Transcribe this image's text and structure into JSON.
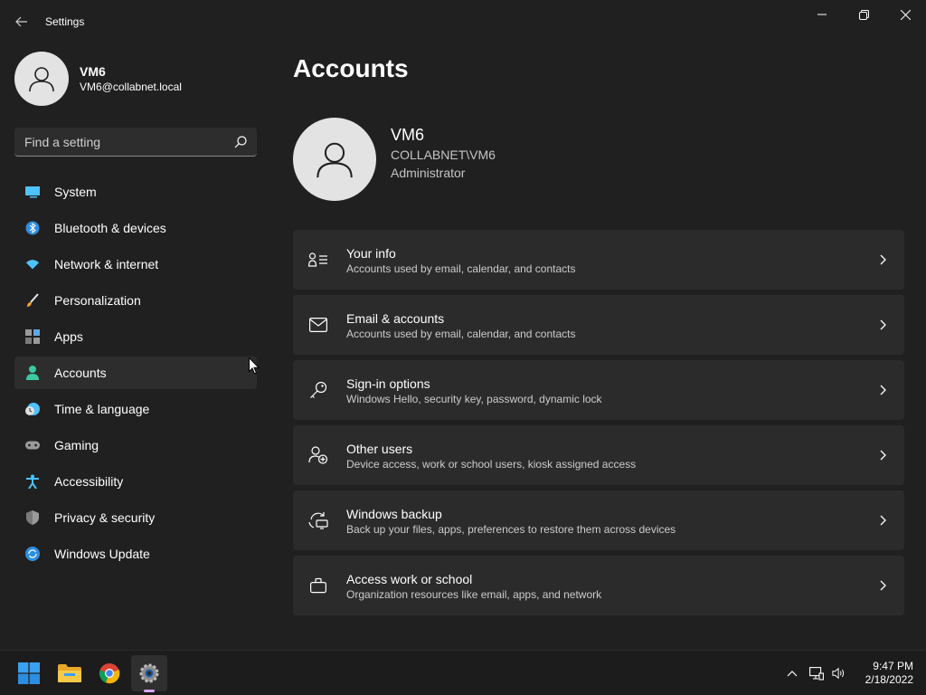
{
  "window": {
    "title": "Settings",
    "controls": [
      "minimize",
      "maximize",
      "close"
    ]
  },
  "profile": {
    "name": "VM6",
    "email": "VM6@collabnet.local"
  },
  "search": {
    "placeholder": "Find a setting"
  },
  "sidebar": {
    "items": [
      {
        "label": "System",
        "icon": "system-icon",
        "active": false
      },
      {
        "label": "Bluetooth & devices",
        "icon": "bluetooth-icon",
        "active": false
      },
      {
        "label": "Network & internet",
        "icon": "wifi-icon",
        "active": false
      },
      {
        "label": "Personalization",
        "icon": "brush-icon",
        "active": false
      },
      {
        "label": "Apps",
        "icon": "apps-icon",
        "active": false
      },
      {
        "label": "Accounts",
        "icon": "person-icon",
        "active": true
      },
      {
        "label": "Time & language",
        "icon": "clock-globe-icon",
        "active": false
      },
      {
        "label": "Gaming",
        "icon": "gamepad-icon",
        "active": false
      },
      {
        "label": "Accessibility",
        "icon": "accessibility-icon",
        "active": false
      },
      {
        "label": "Privacy & security",
        "icon": "shield-icon",
        "active": false
      },
      {
        "label": "Windows Update",
        "icon": "update-icon",
        "active": false
      }
    ]
  },
  "main": {
    "title": "Accounts",
    "account": {
      "name": "VM6",
      "domain": "COLLABNET\\VM6",
      "role": "Administrator"
    },
    "cards": [
      {
        "title": "Your info",
        "subtitle": "Accounts used by email, calendar, and contacts",
        "icon": "person-card-icon"
      },
      {
        "title": "Email & accounts",
        "subtitle": "Accounts used by email, calendar, and contacts",
        "icon": "mail-icon"
      },
      {
        "title": "Sign-in options",
        "subtitle": "Windows Hello, security key, password, dynamic lock",
        "icon": "key-icon"
      },
      {
        "title": "Other users",
        "subtitle": "Device access, work or school users, kiosk assigned access",
        "icon": "add-user-icon"
      },
      {
        "title": "Windows backup",
        "subtitle": "Back up your files, apps, preferences to restore them across devices",
        "icon": "backup-icon"
      },
      {
        "title": "Access work or school",
        "subtitle": "Organization resources like email, apps, and network",
        "icon": "briefcase-icon"
      }
    ]
  },
  "taskbar": {
    "apps": [
      "start-icon",
      "file-explorer-icon",
      "chrome-icon",
      "settings-icon"
    ],
    "time": "9:47 PM",
    "date": "2/18/2022"
  },
  "colors": {
    "background": "#202020",
    "card": "#2b2b2b",
    "accent": "#4cc2ff"
  }
}
